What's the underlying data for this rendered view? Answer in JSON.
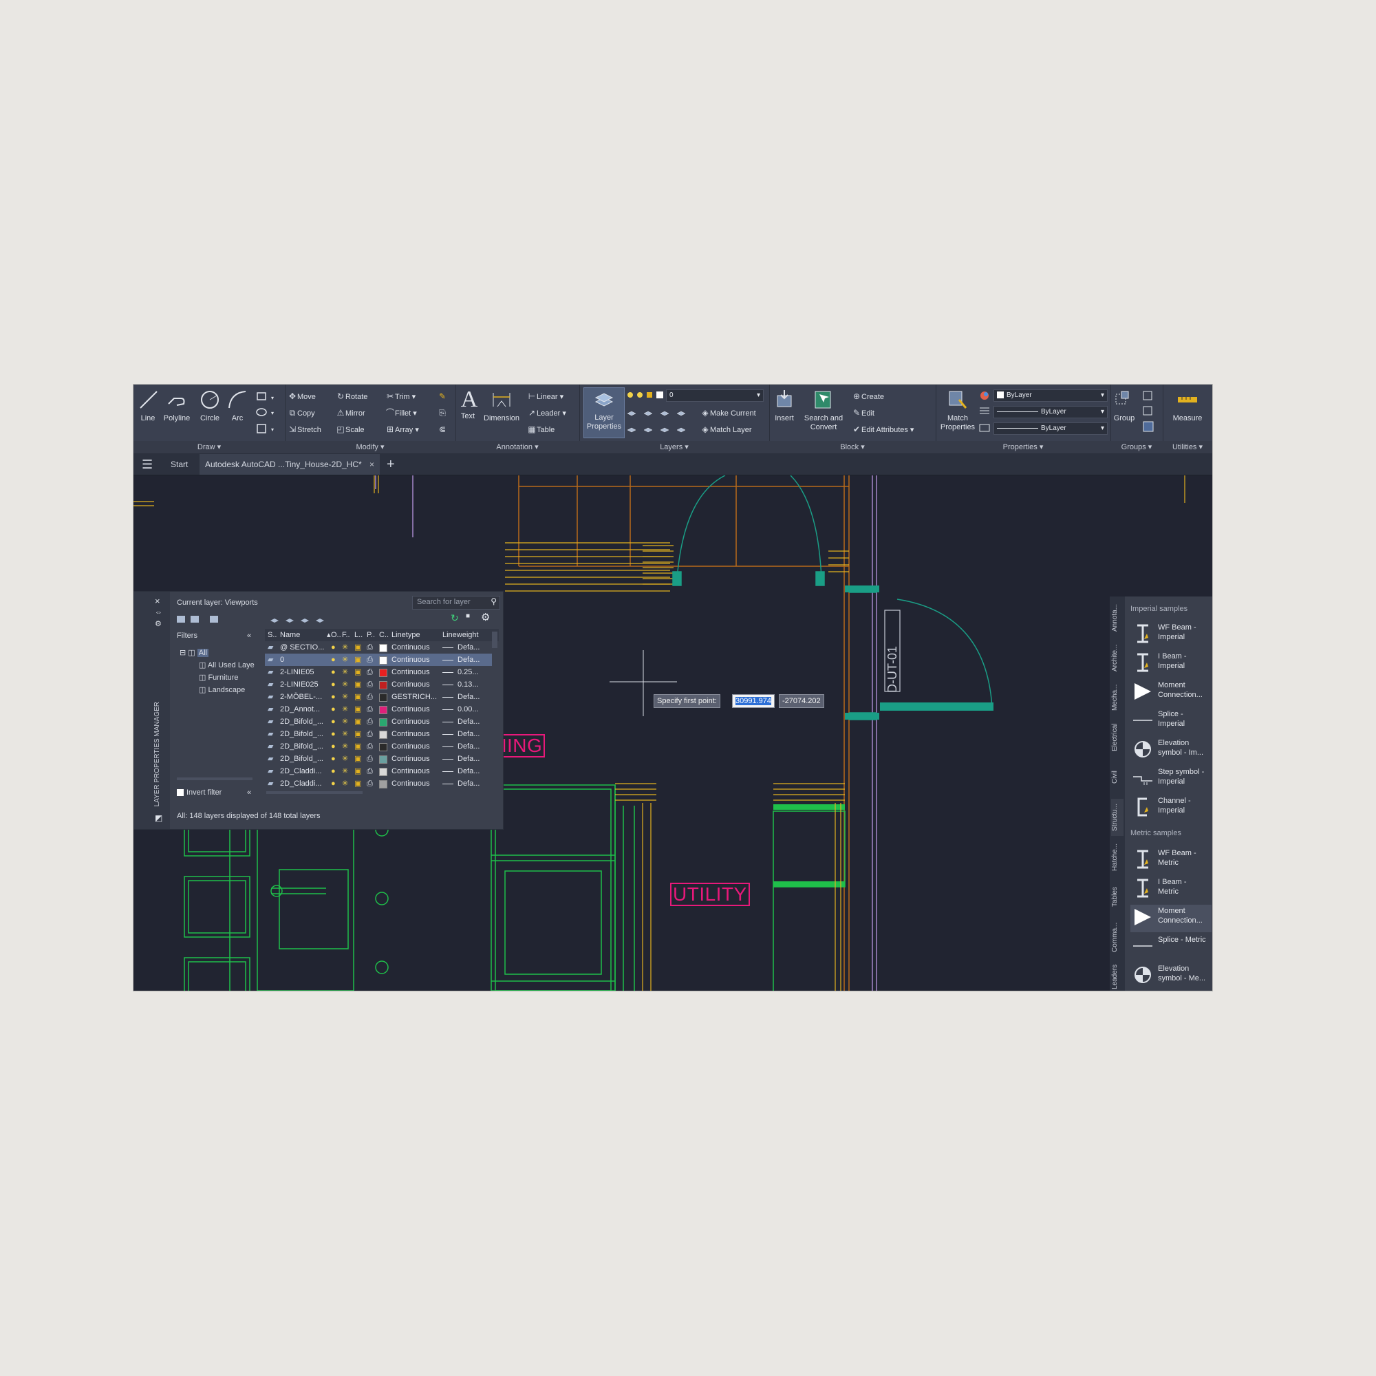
{
  "ribbon": {
    "draw": {
      "title": "Draw",
      "line": "Line",
      "polyline": "Polyline",
      "circle": "Circle",
      "arc": "Arc"
    },
    "modify": {
      "title": "Modify",
      "move": "Move",
      "rotate": "Rotate",
      "trim": "Trim",
      "copy": "Copy",
      "mirror": "Mirror",
      "fillet": "Fillet",
      "stretch": "Stretch",
      "scale": "Scale",
      "array": "Array"
    },
    "annotation": {
      "title": "Annotation",
      "text": "Text",
      "dimension": "Dimension",
      "linear": "Linear",
      "leader": "Leader",
      "table": "Table"
    },
    "layers": {
      "title": "Layers",
      "layer_properties": "Layer Properties",
      "layer_combo": "0",
      "make_current": "Make Current",
      "match_layer": "Match Layer"
    },
    "block": {
      "title": "Block",
      "insert": "Insert",
      "search_convert": "Search and Convert",
      "create": "Create",
      "edit": "Edit",
      "edit_attributes": "Edit Attributes"
    },
    "properties": {
      "title": "Properties",
      "match_properties": "Match Properties",
      "color_combo": "ByLayer",
      "linetype_combo": "ByLayer",
      "lineweight_combo": "ByLayer"
    },
    "groups": {
      "title": "Groups",
      "group": "Group"
    },
    "utilities": {
      "title": "Utilities",
      "measure": "Measure"
    }
  },
  "tabs": {
    "start": "Start",
    "file": "Autodesk AutoCAD ...Tiny_House-2D_HC*"
  },
  "layer_manager": {
    "side_title": "LAYER PROPERTIES MANAGER",
    "current_layer": "Current layer: Viewports",
    "search_placeholder": "Search for layer",
    "filters_label": "Filters",
    "tree": [
      "All",
      "All Used Laye",
      "Furniture",
      "Landscape"
    ],
    "invert_filter": "Invert filter",
    "columns": {
      "s": "S..",
      "name": "Name",
      "o": "O..",
      "f": "F..",
      "l": "L..",
      "p": "P..",
      "c": "C..",
      "linetype": "Linetype",
      "lineweight": "Lineweight"
    },
    "rows": [
      {
        "name": "@ SECTIO...",
        "color": "#ffffff",
        "linetype": "Continuous",
        "lineweight": "Defa..."
      },
      {
        "name": "0",
        "color": "#ffffff",
        "linetype": "Continuous",
        "lineweight": "Defa..."
      },
      {
        "name": "2-LINIE05",
        "color": "#e82020",
        "linetype": "Continuous",
        "lineweight": "0.25..."
      },
      {
        "name": "2-LINIE025",
        "color": "#c02020",
        "linetype": "Continuous",
        "lineweight": "0.13..."
      },
      {
        "name": "2-MÖBEL-...",
        "color": "#2a2a2a",
        "linetype": "GESTRICH...",
        "lineweight": "Defa..."
      },
      {
        "name": "2D_Annot...",
        "color": "#e0207a",
        "linetype": "Continuous",
        "lineweight": "0.00..."
      },
      {
        "name": "2D_Bifold_...",
        "color": "#2aa870",
        "linetype": "Continuous",
        "lineweight": "Defa..."
      },
      {
        "name": "2D_Bifold_...",
        "color": "#d8d8d8",
        "linetype": "Continuous",
        "lineweight": "Defa..."
      },
      {
        "name": "2D_Bifold_...",
        "color": "#2a2a2a",
        "linetype": "Continuous",
        "lineweight": "Defa..."
      },
      {
        "name": "2D_Bifold_...",
        "color": "#6aa0a0",
        "linetype": "Continuous",
        "lineweight": "Defa..."
      },
      {
        "name": "2D_Claddi...",
        "color": "#d8d8d8",
        "linetype": "Continuous",
        "lineweight": "Defa..."
      },
      {
        "name": "2D_Claddi...",
        "color": "#a0a0a0",
        "linetype": "Continuous",
        "lineweight": "Defa..."
      }
    ],
    "status": "All: 148 layers displayed of 148 total layers"
  },
  "drawing": {
    "room_kitchen": "KITCHEN / DINING",
    "room_utility": "UTILITY",
    "door_tag": "D-UT-01",
    "prompt": "Specify first point:",
    "coord_x": "30991.974",
    "coord_y": "-27074.202"
  },
  "tool_palette": {
    "vertical_tabs": [
      "Annota...",
      "Archite...",
      "Mecha...",
      "Electrical",
      "Civil",
      "Structu...",
      "Hatche...",
      "Tables",
      "Comma...",
      "Leaders"
    ],
    "imperial_title": "Imperial samples",
    "imperial_items": [
      {
        "l1": "WF Beam -",
        "l2": "Imperial"
      },
      {
        "l1": "I Beam -",
        "l2": "Imperial"
      },
      {
        "l1": "Moment",
        "l2": "Connection..."
      },
      {
        "l1": "Splice -",
        "l2": "Imperial"
      },
      {
        "l1": "Elevation",
        "l2": "symbol - Im..."
      },
      {
        "l1": "Step symbol -",
        "l2": "Imperial"
      },
      {
        "l1": "Channel -",
        "l2": "Imperial"
      }
    ],
    "metric_title": "Metric samples",
    "metric_items": [
      {
        "l1": "WF Beam -",
        "l2": "Metric"
      },
      {
        "l1": "I Beam -",
        "l2": "Metric"
      },
      {
        "l1": "Moment",
        "l2": "Connection..."
      },
      {
        "l1": "Splice - Metric",
        "l2": ""
      },
      {
        "l1": "Elevation",
        "l2": "symbol - Me..."
      }
    ]
  },
  "colors": {
    "canvas": "#212431",
    "ribbon": "#3a4050",
    "green": "#1fbf4a",
    "yellow": "#e3b21f",
    "magenta": "#e8197a",
    "teal": "#1a9e86",
    "purple": "#a06ad6"
  }
}
